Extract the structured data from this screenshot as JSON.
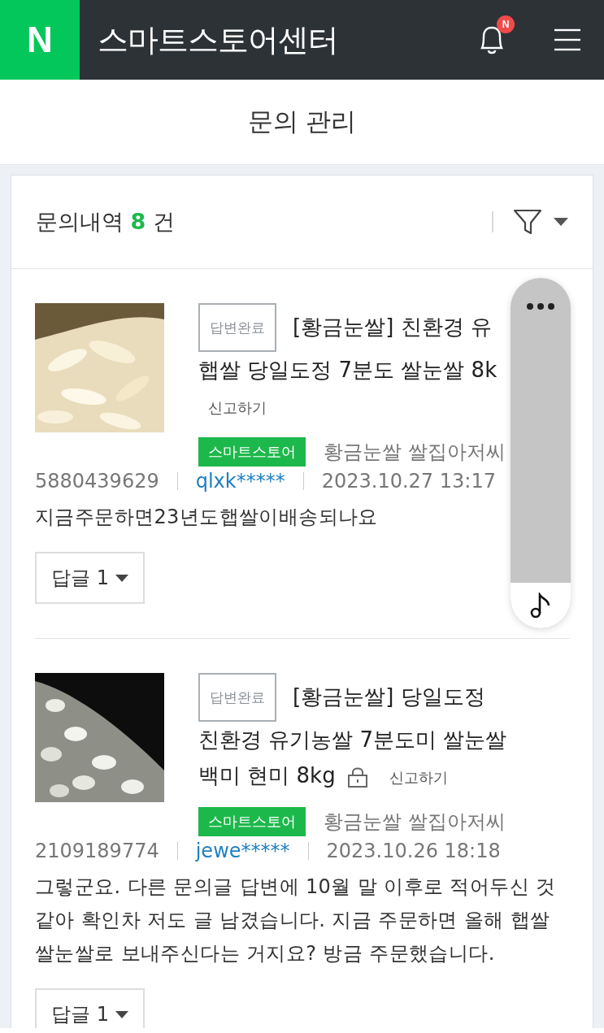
{
  "app_bar": {
    "logo": "N",
    "title": "스마트스토어센터",
    "notification_badge": "N"
  },
  "page_title": "문의 관리",
  "summary": {
    "label": "문의내역",
    "count": "8",
    "unit": "건"
  },
  "inquiries": [
    {
      "picture": {
        "kind": "picture"
      },
      "status": "답변완료",
      "title_lines": [
        "[황금눈쌀] 친환경 유",
        "햅쌀 당일도정 7분도 쌀눈쌀 8k"
      ],
      "locked": false,
      "report": "신고하기",
      "channel": "스마트스토어",
      "seller": "황금눈쌀 쌀집아저씨",
      "order_no": "5880439629",
      "user": "qlxk*****",
      "date": "2023.10.27 13:17",
      "question": "지금주문하면23년도햅쌀이배송되나요",
      "reply_button": "답글 1"
    },
    {
      "picture": {
        "kind": "picture"
      },
      "status": "답변완료",
      "title_lines": [
        "[황금눈쌀] 당일도정",
        "친환경 유기농쌀 7분도미 쌀눈쌀",
        "백미 현미 8kg"
      ],
      "locked": true,
      "report": "신고하기",
      "channel": "스마트스토어",
      "seller": "황금눈쌀 쌀집아저씨",
      "order_no": "2109189774",
      "user": "jewe*****",
      "date": "2023.10.26 18:18",
      "question": "그렇군요. 다른 문의글 답변에 10월 말 이후로 적어두신 것 같아 확인차 저도 글 남겼습니다. 지금 주문하면 올해 햅쌀 쌀눈쌀로 보내주신다는 거지요? 방금 주문했습니다.",
      "reply_button": "답글 1"
    }
  ]
}
